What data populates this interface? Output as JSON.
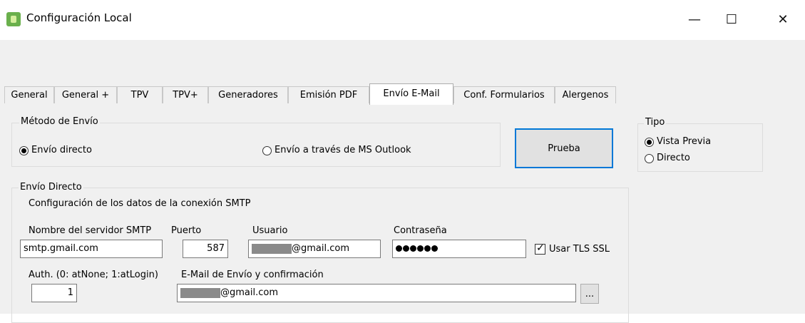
{
  "window": {
    "title": "Configuración Local",
    "minimize": "—",
    "maximize": "☐",
    "close": "✕"
  },
  "tabs": [
    {
      "label": "General"
    },
    {
      "label": "General +"
    },
    {
      "label": "TPV"
    },
    {
      "label": "TPV+"
    },
    {
      "label": "Generadores"
    },
    {
      "label": "Emisión PDF"
    },
    {
      "label": "Envío E-Mail",
      "active": true
    },
    {
      "label": "Conf. Formularios"
    },
    {
      "label": "Alergenos"
    }
  ],
  "metodo_envio": {
    "legend": "Método de Envío",
    "option_directo": "Envío directo",
    "option_outlook": "Envío a través de MS Outlook",
    "selected": "directo"
  },
  "prueba_button": "Prueba",
  "tipo": {
    "legend": "Tipo",
    "option_vista_previa": "Vista Previa",
    "option_directo": "Directo",
    "selected": "vista_previa"
  },
  "envio_directo": {
    "legend": "Envío Directo",
    "subtitle": "Configuración de los datos de la conexión SMTP",
    "server_label": "Nombre del servidor SMTP",
    "server_value": "smtp.gmail.com",
    "port_label": "Puerto",
    "port_value": "587",
    "user_label": "Usuario",
    "user_value": "@gmail.com",
    "password_label": "Contraseña",
    "tls_label": "Usar TLS SSL",
    "tls_checked": true,
    "auth_label": "Auth. (0: atNone; 1:atLogin)",
    "auth_value": "1",
    "email_label": "E-Mail de Envío y confirmación",
    "email_value": "@gmail.com",
    "browse_button": "..."
  }
}
